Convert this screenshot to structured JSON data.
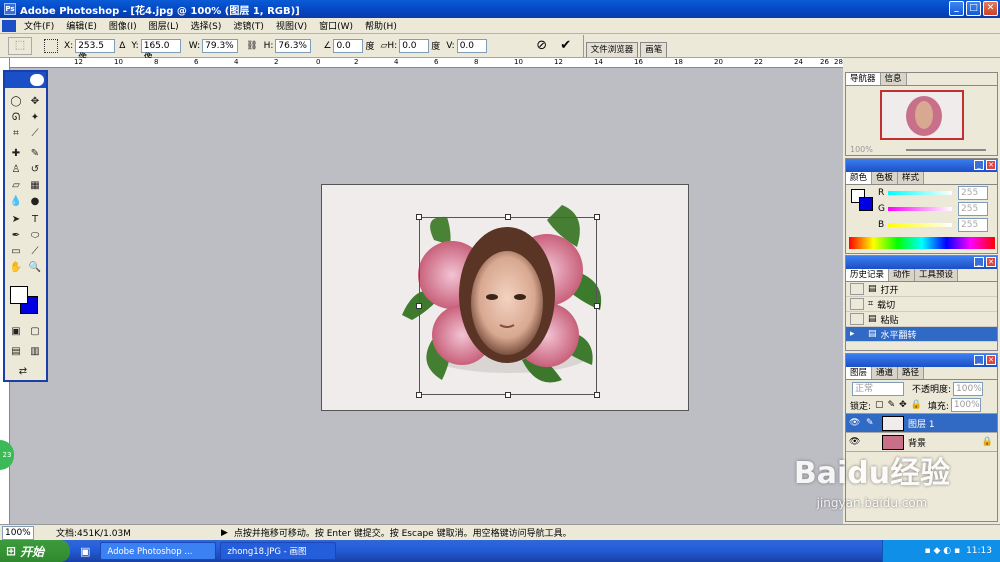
{
  "window": {
    "title": "Adobe Photoshop - [花4.jpg @ 100% (图层 1, RGB)]"
  },
  "menu": [
    "文件(F)",
    "编辑(E)",
    "图像(I)",
    "图层(L)",
    "选择(S)",
    "滤镜(T)",
    "视图(V)",
    "窗口(W)",
    "帮助(H)"
  ],
  "options": {
    "x_label": "X:",
    "x_value": "253.5 像",
    "y_label": "Y:",
    "y_value": "165.0 像",
    "w_label": "W:",
    "w_value": "79.3%",
    "h_label": "H:",
    "h_value": "76.3%",
    "angle_value": "0.0",
    "angle_unit": "度",
    "skew_h_label": "H:",
    "skew_h_value": "0.0",
    "skew_h_unit": "度",
    "skew_v_label": "V:",
    "skew_v_value": "0.0",
    "palette_tabs": [
      "文件浏览器",
      "画笔"
    ]
  },
  "ruler": {
    "ticks": [
      "12",
      "10",
      "8",
      "6",
      "4",
      "2",
      "0",
      "2",
      "4",
      "6",
      "8",
      "10",
      "12",
      "14",
      "16",
      "18",
      "20",
      "22",
      "24",
      "26",
      "28"
    ]
  },
  "navigator": {
    "tabs": [
      "导航器",
      "信息"
    ],
    "zoom": "100%"
  },
  "color": {
    "tabs": [
      "颜色",
      "色板",
      "样式"
    ],
    "channels": [
      {
        "label": "R",
        "value": "255"
      },
      {
        "label": "G",
        "value": "255"
      },
      {
        "label": "B",
        "value": "255"
      }
    ]
  },
  "history": {
    "tabs": [
      "历史记录",
      "动作",
      "工具预设"
    ],
    "items": [
      {
        "label": "打开",
        "selected": false
      },
      {
        "label": "载切",
        "selected": false
      },
      {
        "label": "粘贴",
        "selected": false
      },
      {
        "label": "水平翻转",
        "selected": true
      }
    ]
  },
  "layers": {
    "tabs": [
      "图层",
      "通道",
      "路径"
    ],
    "blend_mode": "正常",
    "opacity_label": "不透明度:",
    "opacity_value": "100%",
    "lock_label": "锁定:",
    "fill_label": "填充:",
    "fill_value": "100%",
    "items": [
      {
        "name": "图层 1",
        "selected": true
      },
      {
        "name": "背景",
        "selected": false
      }
    ]
  },
  "status": {
    "zoom": "100%",
    "doc": "文档:451K/1.03M",
    "hint": "点按并拖移可移动。按 Enter 键提交。按 Escape 键取消。用空格键访问导航工具。"
  },
  "taskbar": {
    "start": "开始",
    "items": [
      "Adobe Photoshop ...",
      "zhong18.JPG - 画图"
    ],
    "clock": "11:13"
  },
  "watermark": {
    "brand": "Baidu经验",
    "url": "jingyan.baidu.com"
  },
  "badge": "23",
  "colors": {
    "title_blue": "#0a5ad6",
    "selection": "#316ac5",
    "workspace": "#bdbdc4"
  }
}
